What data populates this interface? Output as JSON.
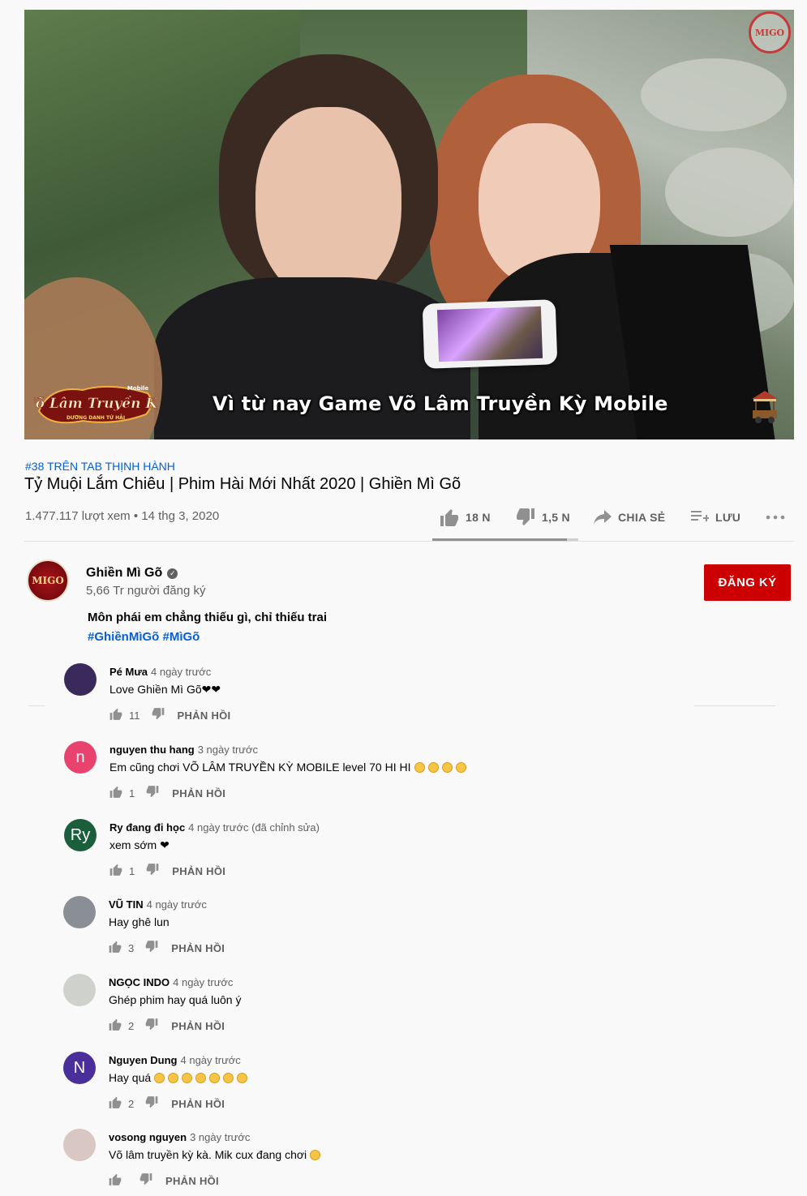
{
  "video": {
    "subtitle": "Vì từ nay Game Võ Lâm Truyền Kỳ Mobile",
    "game_logo_text": "Võ Lâm Truyền Kỳ",
    "game_logo_sub": "Mobile",
    "game_logo_tagline": "DƯƠNG DANH TỨ HẢI",
    "watermark_text": "MIGO"
  },
  "meta": {
    "trending_tag": "#38 TRÊN TAB THỊNH HÀNH",
    "title": "Tỷ Muội Lắm Chiêu | Phim Hài Mới Nhất 2020 | Ghiền Mì Gõ",
    "views_date": "1.477.117 lượt xem • 14 thg 3, 2020"
  },
  "actions": {
    "like_count": "18 N",
    "dislike_count": "1,5 N",
    "share_label": "CHIA SẺ",
    "save_label": "LƯU",
    "like_ratio": 0.92
  },
  "channel": {
    "name": "Ghiền Mì Gõ",
    "subscribers": "5,66 Tr người đăng ký",
    "subscribe_label": "ĐĂNG KÝ",
    "avatar_text": "MIGO",
    "description": "Môn phái em chẳng thiếu gì, chỉ thiếu trai",
    "hashtags": "#GhiềnMìGõ #MìGõ"
  },
  "comments": [
    {
      "author": "Pé Mưa",
      "time": "4 ngày trước",
      "text": "Love Ghiền Mì Gõ❤❤",
      "likes": "11",
      "reply": "PHẢN HỒI",
      "avatar_letter": "",
      "avatar_color": "#3a2a5c"
    },
    {
      "author": "nguyen thu hang",
      "time": "3 ngày trước",
      "text": "Em cũng chơi VÕ LÂM TRUYỀN KỲ MOBILE level 70 HI HI",
      "likes": "1",
      "reply": "PHẢN HỒI",
      "avatar_letter": "n",
      "avatar_color": "#e8436f"
    },
    {
      "author": "Ry đang đi học",
      "time": "4 ngày trước (đã chỉnh sửa)",
      "text": "xem sớm ❤",
      "likes": "1",
      "reply": "PHẢN HỒI",
      "avatar_letter": "Ry",
      "avatar_color": "#1b5e3b"
    },
    {
      "author": "VŨ TIN",
      "time": "4 ngày trước",
      "text": "Hay ghê lun",
      "likes": "3",
      "reply": "PHẢN HỒI",
      "avatar_letter": "",
      "avatar_color": "#8a8f95"
    },
    {
      "author": "NGỌC INDO",
      "time": "4 ngày trước",
      "text": "Ghép phim hay quá luôn ý",
      "likes": "2",
      "reply": "PHẢN HỒI",
      "avatar_letter": "",
      "avatar_color": "#cfd2cc"
    },
    {
      "author": "Nguyen Dung",
      "time": "4 ngày trước",
      "text": "Hay quá",
      "likes": "2",
      "reply": "PHẢN HỒI",
      "avatar_letter": "N",
      "avatar_color": "#4a2f9a"
    },
    {
      "author": "vosong nguyen",
      "time": "3 ngày trước",
      "text": "Võ lâm truyền kỳ kà. Mik cux đang chơi",
      "likes": "",
      "reply": "PHẢN HỒI",
      "avatar_letter": "",
      "avatar_color": "#d9c7c3"
    }
  ],
  "colors": {
    "link_blue": "#065fd4",
    "subscribe_red": "#cc0000",
    "icon_grey": "#909090",
    "text_grey": "#606060"
  }
}
